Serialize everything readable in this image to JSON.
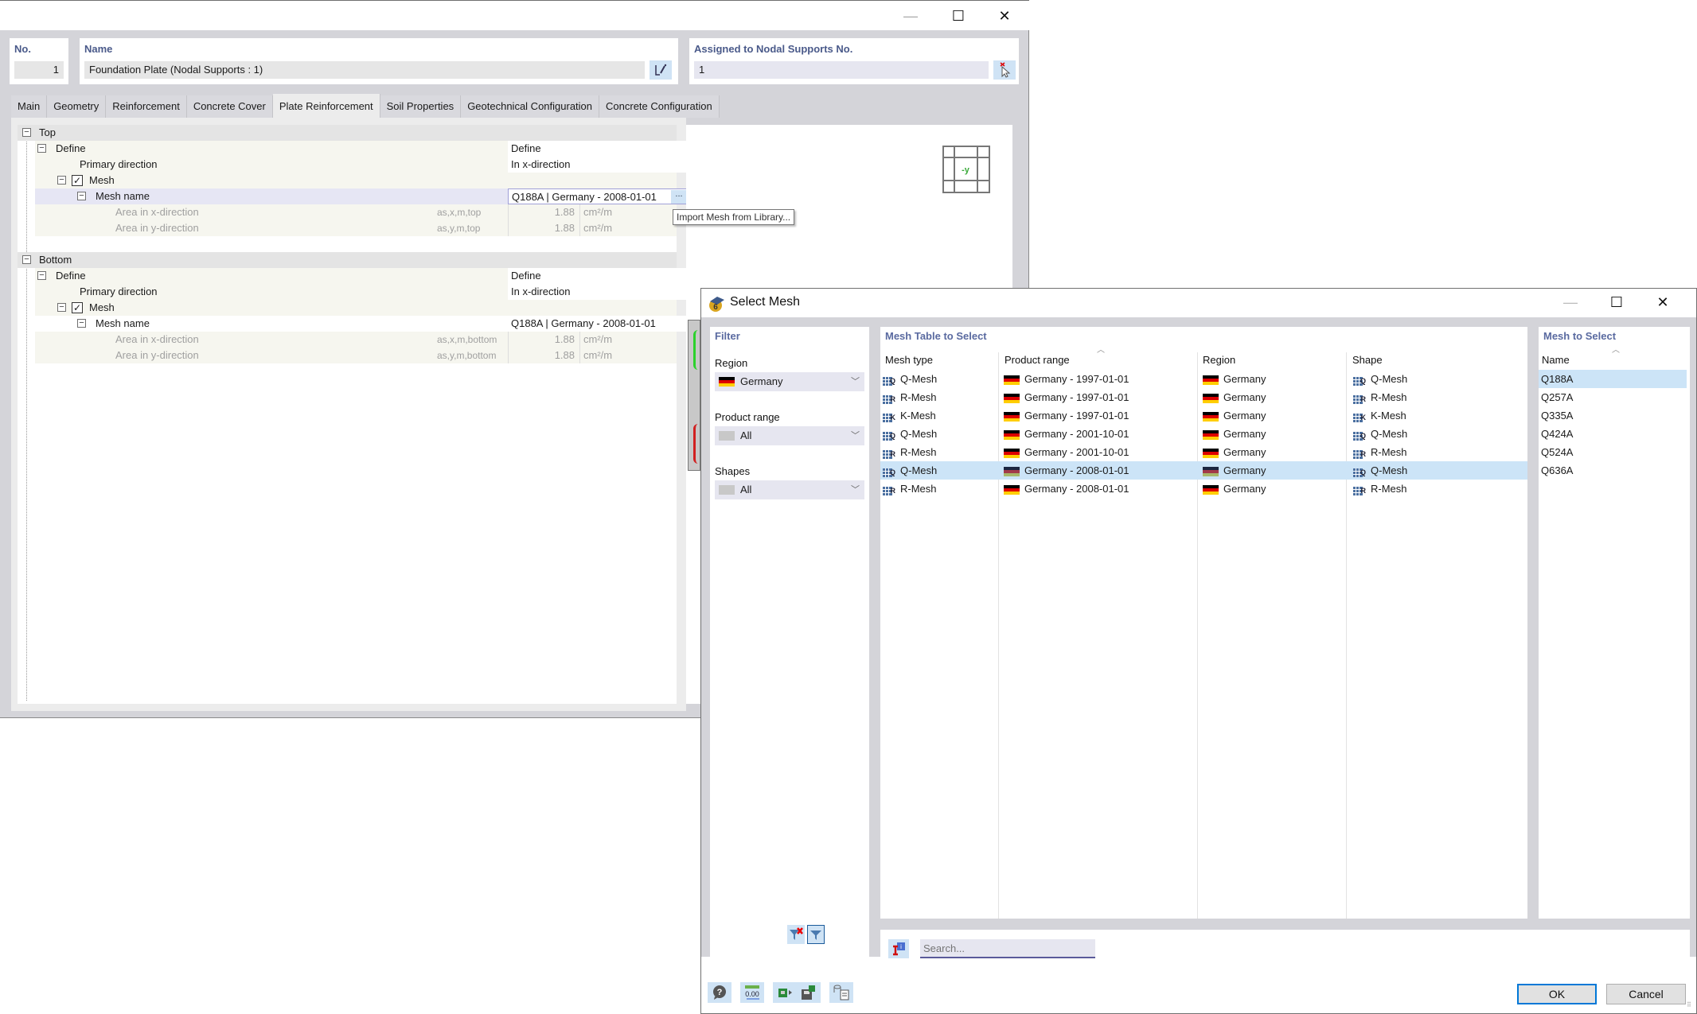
{
  "main_window": {
    "header": {
      "no_label": "No.",
      "no_value": "1",
      "name_label": "Name",
      "name_value": "Foundation Plate (Nodal Supports : 1)",
      "assigned_label": "Assigned to Nodal Supports No.",
      "assigned_value": "1"
    },
    "tabs": [
      "Main",
      "Geometry",
      "Reinforcement",
      "Concrete Cover",
      "Plate Reinforcement",
      "Soil Properties",
      "Geotechnical Configuration",
      "Concrete Configuration"
    ],
    "active_tab": "Plate Reinforcement",
    "tree": {
      "top": {
        "label": "Top",
        "define_label": "Define",
        "define_value": "Define",
        "primary_direction_label": "Primary direction",
        "primary_direction_value": "In x-direction",
        "mesh_label": "Mesh",
        "mesh_checked": true,
        "mesh_name_label": "Mesh name",
        "mesh_name_value": "Q188A | Germany - 2008-01-01",
        "area_x_label": "Area in x-direction",
        "area_x_symbol": "as,x,m,top",
        "area_x_value": "1.88",
        "area_x_unit": "cm²/m",
        "area_y_label": "Area in y-direction",
        "area_y_symbol": "as,y,m,top",
        "area_y_value": "1.88",
        "area_y_unit": "cm²/m"
      },
      "bottom": {
        "label": "Bottom",
        "define_label": "Define",
        "define_value": "Define",
        "primary_direction_label": "Primary direction",
        "primary_direction_value": "In x-direction",
        "mesh_label": "Mesh",
        "mesh_checked": true,
        "mesh_name_label": "Mesh name",
        "mesh_name_value": "Q188A | Germany - 2008-01-01",
        "area_x_label": "Area in x-direction",
        "area_x_symbol": "as,x,m,bottom",
        "area_x_value": "1.88",
        "area_x_unit": "cm²/m",
        "area_y_label": "Area in y-direction",
        "area_y_symbol": "as,y,m,bottom",
        "area_y_value": "1.88",
        "area_y_unit": "cm²/m"
      }
    },
    "ellipsis_label": "...",
    "tooltip": "Import Mesh from Library...",
    "preview_axis_label": "-y"
  },
  "select_mesh": {
    "title": "Select Mesh",
    "filter": {
      "title": "Filter",
      "region_label": "Region",
      "region_value": "Germany",
      "product_range_label": "Product range",
      "product_range_value": "All",
      "shapes_label": "Shapes",
      "shapes_value": "All"
    },
    "table": {
      "title": "Mesh Table to Select",
      "columns": [
        "Mesh type",
        "Product range",
        "Region",
        "Shape"
      ],
      "sorted_column": "Product range",
      "rows": [
        {
          "mesh_type": "Q-Mesh",
          "type_letter": "Q",
          "product_range": "Germany - 1997-01-01",
          "region": "Germany",
          "shape": "Q-Mesh"
        },
        {
          "mesh_type": "R-Mesh",
          "type_letter": "R",
          "product_range": "Germany - 1997-01-01",
          "region": "Germany",
          "shape": "R-Mesh"
        },
        {
          "mesh_type": "K-Mesh",
          "type_letter": "K",
          "product_range": "Germany - 1997-01-01",
          "region": "Germany",
          "shape": "K-Mesh"
        },
        {
          "mesh_type": "Q-Mesh",
          "type_letter": "Q",
          "product_range": "Germany - 2001-10-01",
          "region": "Germany",
          "shape": "Q-Mesh"
        },
        {
          "mesh_type": "R-Mesh",
          "type_letter": "R",
          "product_range": "Germany - 2001-10-01",
          "region": "Germany",
          "shape": "R-Mesh"
        },
        {
          "mesh_type": "Q-Mesh",
          "type_letter": "Q",
          "product_range": "Germany - 2008-01-01",
          "region": "Germany",
          "shape": "Q-Mesh",
          "selected": true
        },
        {
          "mesh_type": "R-Mesh",
          "type_letter": "R",
          "product_range": "Germany - 2008-01-01",
          "region": "Germany",
          "shape": "R-Mesh"
        }
      ]
    },
    "mesh_list": {
      "title": "Mesh to Select",
      "column": "Name",
      "items": [
        "Q188A",
        "Q257A",
        "Q335A",
        "Q424A",
        "Q524A",
        "Q636A"
      ],
      "selected": "Q188A"
    },
    "search_placeholder": "Search...",
    "ok_label": "OK",
    "cancel_label": "Cancel"
  },
  "colors": {
    "accent_title": "#5a6aa0",
    "selection": "#cce4f7",
    "default_button_border": "#0078d7"
  }
}
